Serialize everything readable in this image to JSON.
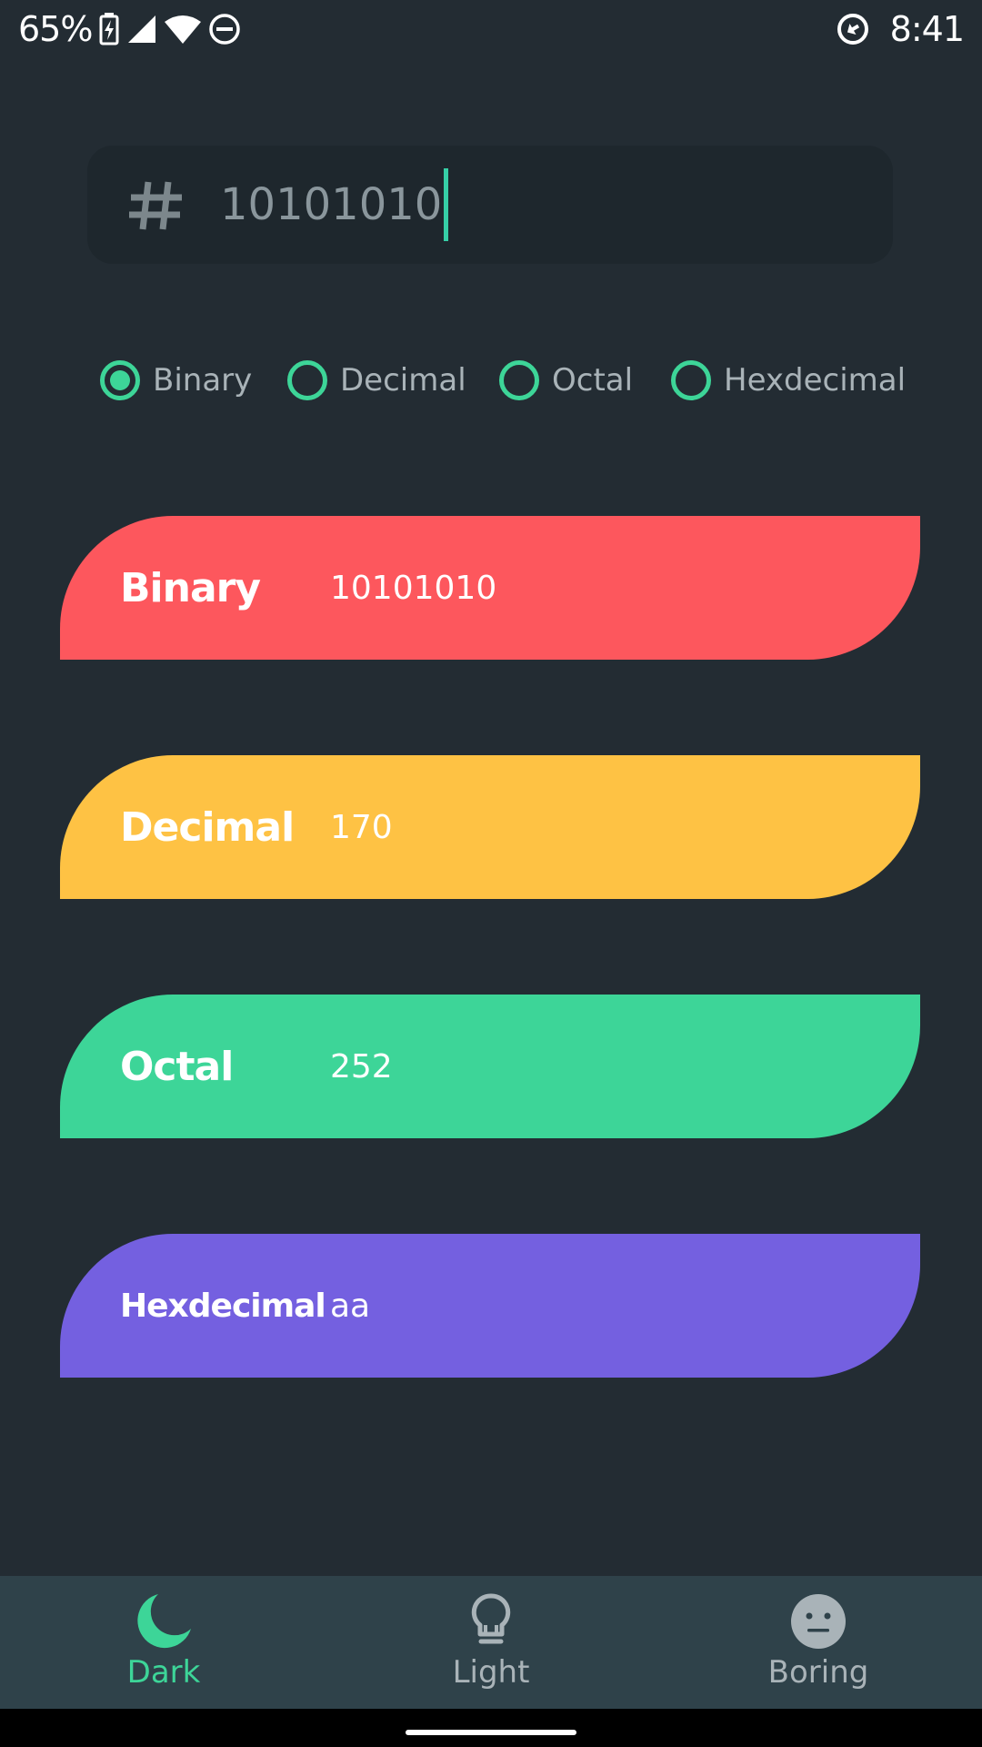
{
  "status_bar": {
    "battery": "65%",
    "time": "8:41"
  },
  "input": {
    "value": "10101010"
  },
  "radio_options": [
    {
      "label": "Binary",
      "checked": true
    },
    {
      "label": "Decimal",
      "checked": false
    },
    {
      "label": "Octal",
      "checked": false
    },
    {
      "label": "Hexdecimal",
      "checked": false
    }
  ],
  "results": [
    {
      "label": "Binary",
      "value": "10101010",
      "color": "#fd575d"
    },
    {
      "label": "Decimal",
      "value": "170",
      "color": "#fec244"
    },
    {
      "label": "Octal",
      "value": "252",
      "color": "#3dd598"
    },
    {
      "label": "Hexdecimal",
      "value": "aa",
      "color": "#7460e0"
    }
  ],
  "bottom_nav": [
    {
      "label": "Dark",
      "icon": "moon-icon",
      "active": true
    },
    {
      "label": "Light",
      "icon": "lightbulb-icon",
      "active": false
    },
    {
      "label": "Boring",
      "icon": "neutral-face-icon",
      "active": false
    }
  ],
  "colors": {
    "background": "#232c33",
    "input_background": "#1e272d",
    "accent": "#3dd598",
    "caret": "#36cfa6",
    "nav_background": "#2f424a",
    "nav_active": "#3dd598",
    "nav_inactive": "#a9b3b8"
  }
}
